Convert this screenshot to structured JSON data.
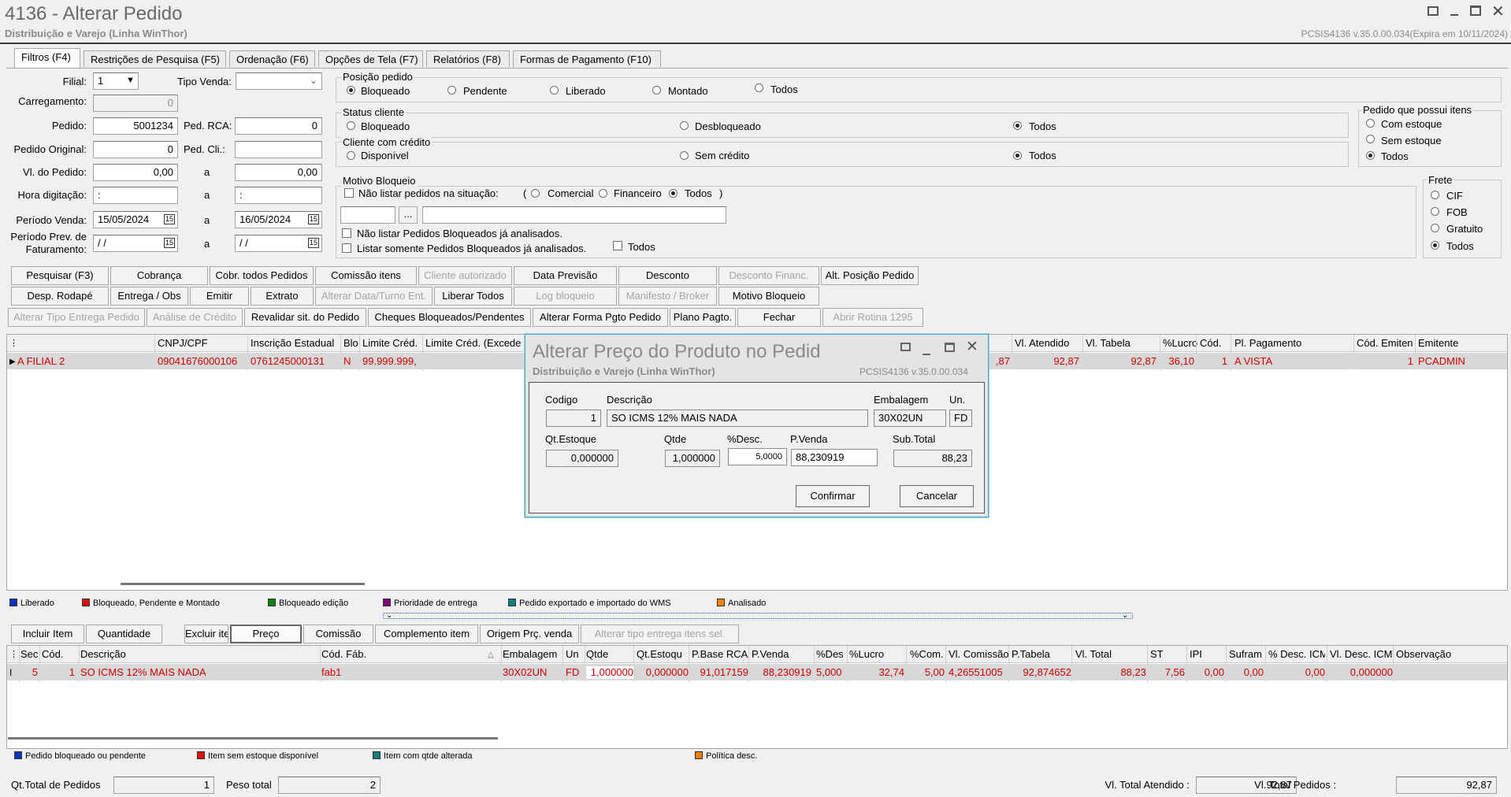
{
  "window": {
    "title": "4136 - Alterar Pedido",
    "subtitle": "Distribuição e Varejo (Linha WinThor)",
    "version": "PCSIS4136  v.35.0.00.034(Expira em 10/11/2024)"
  },
  "tabs": [
    "Filtros (F4)",
    "Restrições de Pesquisa (F5)",
    "Ordenação (F6)",
    "Opções de Tela (F7)",
    "Relatórios (F8)",
    "Formas de Pagamento (F10)"
  ],
  "filters": {
    "filial_label": "Filial:",
    "filial_value": "1",
    "tipo_venda_label": "Tipo Venda:",
    "tipo_venda_value": "",
    "carregamento_label": "Carregamento:",
    "carregamento_value": "0",
    "pedido_label": "Pedido:",
    "pedido_value": "5001234",
    "ped_rca_label": "Ped. RCA:",
    "ped_rca_value": "0",
    "pedido_original_label": "Pedido Original:",
    "pedido_original_value": "0",
    "ped_cli_label": "Ped. Cli.:",
    "ped_cli_value": "",
    "vl_pedido_label": "Vl. do Pedido:",
    "vl_pedido_from": "0,00",
    "a_label": "a",
    "vl_pedido_to": "0,00",
    "hora_label": "Hora digitação:",
    "hora_from": ":",
    "hora_to": ":",
    "periodo_venda_label": "Período Venda:",
    "periodo_venda_from": "15/05/2024",
    "periodo_venda_to": "16/05/2024",
    "periodo_prev_label1": "Período Prev. de",
    "periodo_prev_label2": "Faturamento:",
    "periodo_prev_from": "/ /",
    "periodo_prev_to": "/ /",
    "cal_icon": "15"
  },
  "posicao": {
    "title": "Posição pedido",
    "options": [
      "Bloqueado",
      "Pendente",
      "Liberado",
      "Montado",
      "Todos"
    ]
  },
  "status_cliente": {
    "title": "Status cliente",
    "options": [
      "Bloqueado",
      "Desbloqueado",
      "Todos"
    ]
  },
  "cliente_credito": {
    "title": "Cliente com crédito",
    "options": [
      "Disponível",
      "Sem crédito",
      "Todos"
    ]
  },
  "pedido_itens": {
    "title": "Pedido que possui itens",
    "options": [
      "Com estoque",
      "Sem estoque",
      "Todos"
    ]
  },
  "frete": {
    "title": "Frete",
    "options": [
      "CIF",
      "FOB",
      "Gratuito",
      "Todos"
    ]
  },
  "motivo": {
    "title": "Motivo Bloqueio",
    "nao_listar_label": "Não listar pedidos na situação:",
    "paren_open": "(",
    "paren_close": ")",
    "opts": [
      "Comercial",
      "Financeiro",
      "Todos"
    ],
    "ellipsis": "...",
    "chk1": "Não listar Pedidos Bloqueados já analisados.",
    "chk2": "Listar somente Pedidos Bloqueados já analisados.",
    "chk3": "Todos"
  },
  "buttons": {
    "row1": [
      "Pesquisar (F3)",
      "Cobrança",
      "Cobr. todos Pedidos",
      "Comissão itens",
      "Cliente autorizado",
      "Data Previsão",
      "Desconto",
      "Desconto Financ.",
      "Alt. Posição Pedido"
    ],
    "row2": [
      "Desp. Rodapé",
      "Entrega / Obs",
      "Emitir",
      "Extrato",
      "Alterar Data/Turno Ent.",
      "Liberar Todos",
      "Log bloqueio",
      "Manifesto / Broker",
      "Motivo Bloqueio"
    ],
    "row3": [
      "Alterar Tipo Entrega Pedido",
      "Análise de Crédito",
      "Revalidar sit. do Pedido",
      "Cheques Bloqueados/Pendentes",
      "Alterar Forma Pgto Pedido",
      "Plano Pagto.",
      "Fechar",
      "Abrir Rotina 1295"
    ]
  },
  "orders_grid": {
    "headers": [
      "CNPJ/CPF",
      "Inscrição Estadual",
      "Blo",
      "Limite Créd.",
      "Limite Créd. (Excede",
      "Vl. Atendido",
      "Vl. Tabela",
      "%Lucro",
      "Cód.",
      "Pl. Pagamento",
      "Cód. Emiten",
      "Emitente"
    ],
    "row": {
      "name": "A FILIAL 2",
      "cnpj": "09041676000106",
      "ie": "0761245000131",
      "blo": "N",
      "limite": "99.999.999,",
      "atendido_partial": ",87",
      "vl_atendido": "92,87",
      "vl_tabela": "92,87",
      "lucro": "36,10",
      "cod": "1",
      "pl_pag": "A VISTA",
      "cod_emit": "1",
      "emitente": "PCADMIN"
    }
  },
  "legend1": [
    "Liberado",
    "Bloqueado, Pendente e Montado",
    "Bloqueado edição",
    "Prioridade de entrega",
    "Pedido exportado e importado do WMS",
    "Analisado"
  ],
  "legend1_colors": [
    "#1030c0",
    "#e01010",
    "#108010",
    "#800080",
    "#108080",
    "#f08000"
  ],
  "item_buttons": [
    "Incluir Item",
    "Quantidade",
    "Excluir item",
    "Preço",
    "Comissão",
    "Complemento item",
    "Origem Prç. venda",
    "Alterar tipo entrega itens sel."
  ],
  "items_grid": {
    "headers": [
      "Sec",
      "Cód.",
      "Descrição",
      "Cód. Fáb.",
      "Embalagem",
      "Un",
      "Qtde",
      "Qt.Estoqu",
      "P.Base RCA",
      "P.Venda",
      "%Des",
      "%Lucro",
      "%Com.",
      "Vl. Comissão",
      "P.Tabela",
      "Vl. Total",
      "ST",
      "IPI",
      "Sufram",
      "% Desc. ICM",
      "Vl. Desc. ICM",
      "Observação"
    ],
    "row": [
      "5",
      "1",
      "SO ICMS 12% MAIS NADA",
      "fab1",
      "30X02UN",
      "FD",
      "1,000000",
      "0,000000",
      "91,017159",
      "88,230919",
      "5,000",
      "32,74",
      "5,00",
      "4,26551005",
      "92,874652",
      "88,23",
      "7,56",
      "0,00",
      "0,00",
      "0,00",
      "0,000000",
      ""
    ]
  },
  "legend2": [
    "Pedido bloqueado ou pendente",
    "Item sem estoque disponível",
    "Item com qtde alterada",
    "Política desc."
  ],
  "legend2_colors": [
    "#1030c0",
    "#e01010",
    "#108080",
    "#f08000"
  ],
  "footer": {
    "qt_label": "Qt.Total de Pedidos",
    "qt_value": "1",
    "peso_label": "Peso total",
    "peso_value": "2",
    "vl_atendido_label": "Vl. Total Atendido :",
    "vl_atendido_value": "92,87",
    "vl_pedidos_label": "Vl. Total Pedidos :",
    "vl_pedidos_value": "92,87"
  },
  "dialog": {
    "title": "Alterar Preço do Produto no Pedid",
    "subtitle": "Distribuição e Varejo (Linha WinThor)",
    "version": "PCSIS4136  v.35.0.00.034",
    "codigo_label": "Codigo",
    "codigo": "1",
    "descricao_label": "Descrição",
    "descricao": "SO ICMS 12% MAIS NADA",
    "embalagem_label": "Embalagem",
    "embalagem": "30X02UN",
    "un_label": "Un.",
    "un": "FD",
    "qt_estoque_label": "Qt.Estoque",
    "qt_estoque": "0,000000",
    "qtde_label": "Qtde",
    "qtde": "1,000000",
    "desc_label": "%Desc.",
    "desc": "5,0000",
    "pvenda_label": "P.Venda",
    "pvenda": "88,230919",
    "subtotal_label": "Sub.Total",
    "subtotal": "88,23",
    "confirm": "Confirmar",
    "cancel": "Cancelar"
  }
}
